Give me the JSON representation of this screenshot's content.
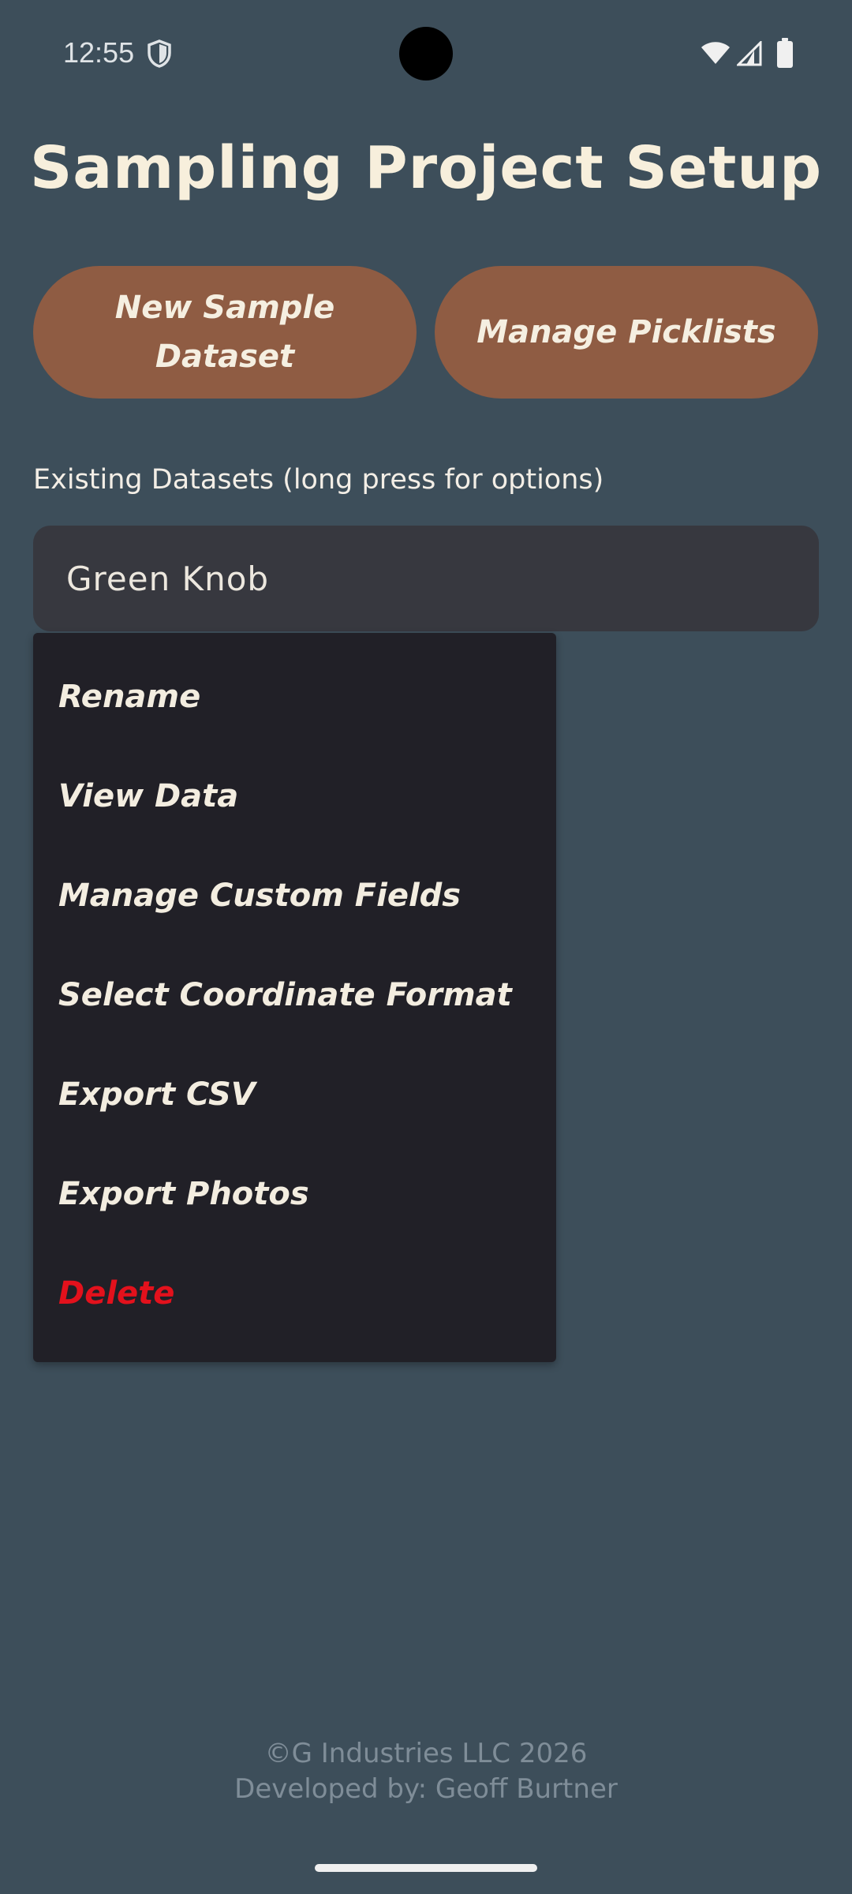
{
  "status_bar": {
    "time": "12:55",
    "icons": [
      "shield-icon",
      "wifi-icon",
      "signal-icon",
      "battery-icon"
    ]
  },
  "header": {
    "title": "Sampling Project Setup"
  },
  "actions": {
    "new_dataset_label": "New Sample Dataset",
    "manage_picklists_label": "Manage Picklists"
  },
  "datasets": {
    "label": "Existing Datasets (long press for options)",
    "selected": "Green Knob"
  },
  "context_menu": {
    "items": [
      {
        "label": "Rename"
      },
      {
        "label": "View Data"
      },
      {
        "label": "Manage Custom Fields"
      },
      {
        "label": "Select Coordinate Format"
      },
      {
        "label": "Export CSV"
      },
      {
        "label": "Export Photos"
      },
      {
        "label": "Delete"
      }
    ]
  },
  "footer": {
    "copyright": "©G Industries LLC 2026",
    "developer": "Developed by: Geoff Burtner"
  },
  "colors": {
    "background": "#3d4e5a",
    "accent_button": "#8f5c43",
    "menu_background": "#212027",
    "danger": "#e3111c"
  }
}
